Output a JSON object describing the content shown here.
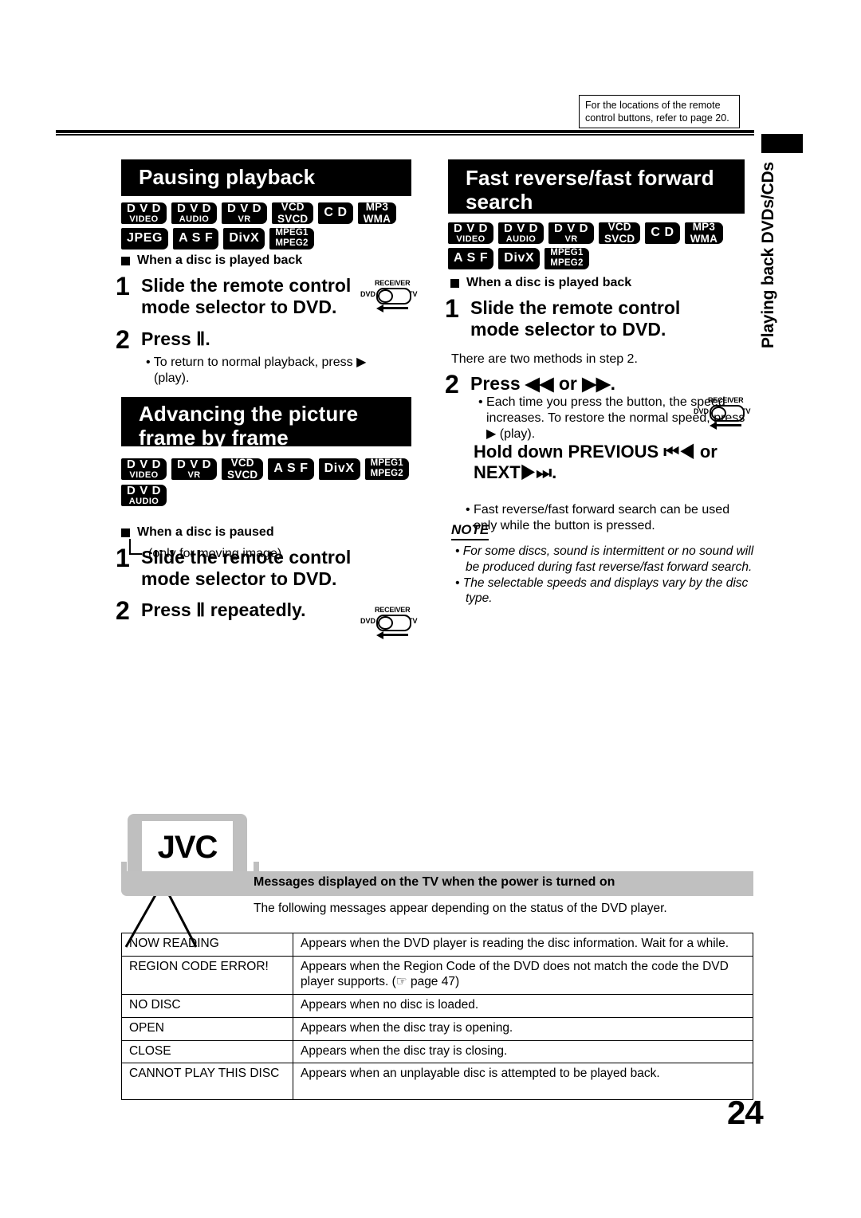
{
  "page": {
    "number": "24",
    "side_tab": "Playing back DVDs/CDs",
    "ref_note": "For the locations of the remote control buttons, refer to page 20."
  },
  "sections": {
    "pausing": {
      "title": "Pausing playback",
      "badges": [
        {
          "l1": "D V D",
          "l2": "VIDEO",
          "style": "stacked"
        },
        {
          "l1": "D V D",
          "l2": "AUDIO",
          "style": "stacked"
        },
        {
          "l1": "D V D",
          "l2": "VR",
          "style": "stacked"
        },
        {
          "l1": "VCD",
          "l2": "SVCD",
          "style": "two-eq"
        },
        {
          "l1": "C D",
          "l2": "",
          "style": "single"
        },
        {
          "l1": "MP3",
          "l2": "WMA",
          "style": "two-eq"
        },
        {
          "l1": "JPEG",
          "l2": "",
          "style": "single"
        },
        {
          "l1": "A S F",
          "l2": "",
          "style": "single"
        },
        {
          "l1": "DivX",
          "l2": "",
          "style": "single"
        },
        {
          "l1": "MPEG1",
          "l2": "MPEG2",
          "style": "mpeg"
        }
      ],
      "subhead": "When a disc is played back",
      "step1_num": "1",
      "step1_text": "Slide the remote control mode selector to DVD.",
      "step2_num": "2",
      "step2_text": "Press Ⅱ.",
      "step2_bullet": "• To return to normal playback, press ▶ (play)."
    },
    "advancing": {
      "title_line1": "Advancing the picture",
      "title_line2": "frame by frame",
      "badges": [
        {
          "l1": "D V D",
          "l2": "VIDEO",
          "style": "stacked"
        },
        {
          "l1": "D V D",
          "l2": "VR",
          "style": "stacked"
        },
        {
          "l1": "VCD",
          "l2": "SVCD",
          "style": "two-eq"
        },
        {
          "l1": "A S F",
          "l2": "",
          "style": "single"
        },
        {
          "l1": "DivX",
          "l2": "",
          "style": "single"
        },
        {
          "l1": "MPEG1",
          "l2": "MPEG2",
          "style": "mpeg"
        }
      ],
      "badge_audio": {
        "l1": "D V D",
        "l2": "AUDIO",
        "style": "stacked"
      },
      "moving_note": "(only for moving image)",
      "subhead": "When a disc is paused",
      "step1_num": "1",
      "step1_text": "Slide the remote control mode selector to DVD.",
      "step2_num": "2",
      "step2_text": "Press Ⅱ repeatedly."
    },
    "fast_search": {
      "title_line1": "Fast reverse/fast forward",
      "title_line2": "search",
      "badges": [
        {
          "l1": "D V D",
          "l2": "VIDEO",
          "style": "stacked"
        },
        {
          "l1": "D V D",
          "l2": "AUDIO",
          "style": "stacked"
        },
        {
          "l1": "D V D",
          "l2": "VR",
          "style": "stacked"
        },
        {
          "l1": "VCD",
          "l2": "SVCD",
          "style": "two-eq"
        },
        {
          "l1": "C D",
          "l2": "",
          "style": "single"
        },
        {
          "l1": "MP3",
          "l2": "WMA",
          "style": "two-eq"
        },
        {
          "l1": "A S F",
          "l2": "",
          "style": "single"
        },
        {
          "l1": "DivX",
          "l2": "",
          "style": "single"
        },
        {
          "l1": "MPEG1",
          "l2": "MPEG2",
          "style": "mpeg"
        }
      ],
      "subhead": "When a disc is played back",
      "step1_num": "1",
      "step1_text": "Slide the remote control mode selector to DVD.",
      "methods_line": "There are two methods in step 2.",
      "step2_num": "2",
      "step2_text": "Press ◀◀ or ▶▶.",
      "step2_bullet": "• Each time you press the button, the speed increases. To restore the normal speed, press ▶ (play).",
      "hold_heading": "Hold down PREVIOUS ⏮◀ or NEXT▶⏭.",
      "hold_bullet": "• Fast reverse/fast forward search can be used only while the button is pressed.",
      "note_title": "NOTE",
      "note_items": [
        "• For some discs, sound is intermittent or no sound will be produced during fast reverse/fast forward search.",
        "• The selectable speeds and displays vary by the disc type."
      ]
    }
  },
  "selector": {
    "receiver_label": "RECEIVER",
    "dvd_label": "DVD",
    "tv_label": "TV"
  },
  "tv_illustration": {
    "brand": "JVC"
  },
  "messages_section": {
    "band_title": "Messages displayed on the TV when the power is turned on",
    "intro": "The following messages appear depending on the status of the DVD player.",
    "rows": [
      {
        "message": "NOW READING",
        "description": "Appears when the DVD player is reading the disc information. Wait for a while."
      },
      {
        "message": "REGION CODE ERROR!",
        "description": "Appears when the Region Code of the DVD does not match the code the DVD player supports. (☞ page 47)"
      },
      {
        "message": "NO DISC",
        "description": "Appears when no disc is loaded."
      },
      {
        "message": "OPEN",
        "description": "Appears when the disc tray is opening."
      },
      {
        "message": "CLOSE",
        "description": "Appears when the disc tray is closing."
      },
      {
        "message": "CANNOT PLAY THIS DISC",
        "description": "Appears when an unplayable disc is attempted to be played back."
      }
    ]
  }
}
